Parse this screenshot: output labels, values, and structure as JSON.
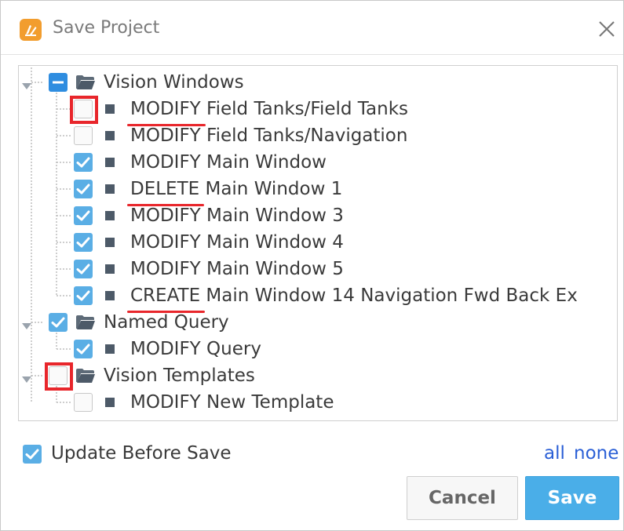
{
  "window": {
    "title": "Save Project",
    "app_icon": "ignition-designer-icon",
    "close_icon": "close-icon"
  },
  "tree": {
    "groups": [
      {
        "label": "Vision Windows",
        "state": "partial",
        "highlighted": false,
        "items": [
          {
            "action": "MODIFY",
            "name": "Field Tanks/Field Tanks",
            "checked": false,
            "highlighted": true,
            "underline": true
          },
          {
            "action": "MODIFY",
            "name": "Field Tanks/Navigation",
            "checked": false,
            "highlighted": false,
            "underline": false
          },
          {
            "action": "MODIFY",
            "name": "Main Window",
            "checked": true,
            "highlighted": false,
            "underline": false
          },
          {
            "action": "DELETE",
            "name": "Main Window 1",
            "checked": true,
            "highlighted": false,
            "underline": true
          },
          {
            "action": "MODIFY",
            "name": "Main Window 3",
            "checked": true,
            "highlighted": false,
            "underline": false
          },
          {
            "action": "MODIFY",
            "name": "Main Window 4",
            "checked": true,
            "highlighted": false,
            "underline": false
          },
          {
            "action": "MODIFY",
            "name": "Main Window 5",
            "checked": true,
            "highlighted": false,
            "underline": false
          },
          {
            "action": "CREATE",
            "name": "Main Window 14 Navigation Fwd Back Ex",
            "checked": true,
            "highlighted": false,
            "underline": true
          }
        ]
      },
      {
        "label": "Named Query",
        "state": "checked",
        "highlighted": false,
        "items": [
          {
            "action": "MODIFY",
            "name": "Query",
            "checked": true,
            "highlighted": false,
            "underline": false
          }
        ]
      },
      {
        "label": "Vision Templates",
        "state": "unchecked",
        "highlighted": true,
        "items": [
          {
            "action": "MODIFY",
            "name": "New Template",
            "checked": false,
            "highlighted": false,
            "underline": false
          }
        ]
      }
    ]
  },
  "footer": {
    "update_before_save_label": "Update Before Save",
    "update_before_save_checked": true,
    "all_link": "all",
    "none_link": "none"
  },
  "buttons": {
    "cancel": "Cancel",
    "save": "Save"
  },
  "colors": {
    "checkbox_checked": "#5aaee5",
    "checkbox_partial": "#2f8de0",
    "highlight_red": "#e8262b",
    "link_blue": "#2a5fd6",
    "save_button": "#4aaee8"
  }
}
